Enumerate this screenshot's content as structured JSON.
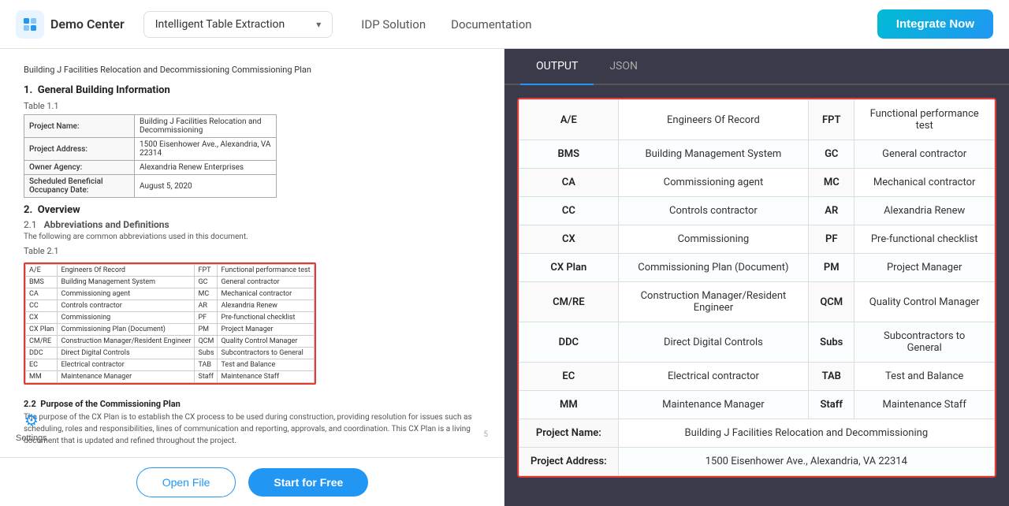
{
  "header": {
    "logo_text": "Demo Center",
    "logo_icon": "🔷",
    "dropdown_label": "Intelligent Table Extraction",
    "nav": [
      {
        "label": "IDP Solution"
      },
      {
        "label": "Documentation"
      }
    ],
    "integrate_btn": "Integrate Now"
  },
  "left_panel": {
    "doc_title": "Building J Facilities Relocation and Decommissioning Commissioning Plan",
    "sections": [
      {
        "num": "1.",
        "heading": "General Building Information",
        "table_label": "Table 1.1",
        "info_rows": [
          {
            "key": "Project Name:",
            "value": "Building J Facilities Relocation and Decommissioning"
          },
          {
            "key": "Project Address:",
            "value": "1500 Eisenhower Ave., Alexandria, VA 22314"
          },
          {
            "key": "Owner Agency:",
            "value": "Alexandria Renew Enterprises"
          },
          {
            "key": "Scheduled Beneficial Occupancy Date:",
            "value": "August 5, 2020"
          }
        ]
      },
      {
        "num": "2.",
        "heading": "Overview",
        "sub_num": "2.1",
        "sub_heading": "Abbreviations and Definitions",
        "sub_text": "The following are common abbreviations used in this document.",
        "table_label": "Table 2.1",
        "abbr_rows": [
          [
            "A/E",
            "Engineers Of Record",
            "FPT",
            "Functional performance test"
          ],
          [
            "BMS",
            "Building Management System",
            "GC",
            "General contractor"
          ],
          [
            "CA",
            "Commissioning agent",
            "MC",
            "Mechanical contractor"
          ],
          [
            "CC",
            "Controls contractor",
            "AR",
            "Alexandria Renew"
          ],
          [
            "CX",
            "Commissioning",
            "PF",
            "Pre-functional checklist"
          ],
          [
            "CX Plan",
            "Commissioning Plan (Document)",
            "PM",
            "Project Manager"
          ],
          [
            "CM/RE",
            "Construction Manager/Resident Engineer",
            "QCM",
            "Quality Control Manager"
          ],
          [
            "DDC",
            "Direct Digital Controls",
            "Subs",
            "Subcontractors to General"
          ],
          [
            "EC",
            "Electrical contractor",
            "TAB",
            "Test and Balance"
          ],
          [
            "MM",
            "Maintenance Manager",
            "Staff",
            "Maintenance Staff"
          ]
        ],
        "purpose_num": "2.2",
        "purpose_heading": "Purpose of the Commissioning Plan",
        "purpose_text": "The purpose of the CX Plan is to establish the CX process to be used during construction, providing resolution for issues such as scheduling, roles and responsibilities, lines of communication and reporting, approvals, and coordination. This CX Plan is a living document that is updated and refined throughout the project."
      }
    ],
    "page_num": "5",
    "settings_label": "Settings",
    "open_file_btn": "Open File",
    "start_free_btn": "Start for Free"
  },
  "right_panel": {
    "tabs": [
      {
        "label": "OUTPUT",
        "active": true
      },
      {
        "label": "JSON",
        "active": false
      }
    ],
    "extracted_rows": [
      [
        "A/E",
        "Engineers Of Record",
        "FPT",
        "Functional performance test"
      ],
      [
        "BMS",
        "Building Management System",
        "GC",
        "General contractor"
      ],
      [
        "CA",
        "Commissioning agent",
        "MC",
        "Mechanical contractor"
      ],
      [
        "CC",
        "Controls contractor",
        "AR",
        "Alexandria Renew"
      ],
      [
        "CX",
        "Commissioning",
        "PF",
        "Pre-functional checklist"
      ],
      [
        "CX Plan",
        "Commissioning Plan (Document)",
        "PM",
        "Project Manager"
      ],
      [
        "CM/RE",
        "Construction Manager/Resident Engineer",
        "QCM",
        "Quality Control Manager"
      ],
      [
        "DDC",
        "Direct Digital Controls",
        "Subs",
        "Subcontractors to General"
      ],
      [
        "EC",
        "Electrical contractor",
        "TAB",
        "Test and Balance"
      ],
      [
        "MM",
        "Maintenance Manager",
        "Staff",
        "Maintenance Staff"
      ]
    ],
    "footer_rows": [
      [
        "Project Name:",
        "Building J Facilities Relocation and Decommissioning"
      ],
      [
        "Project Address:",
        "1500 Eisenhower Ave., Alexandria, VA 22314"
      ]
    ]
  }
}
